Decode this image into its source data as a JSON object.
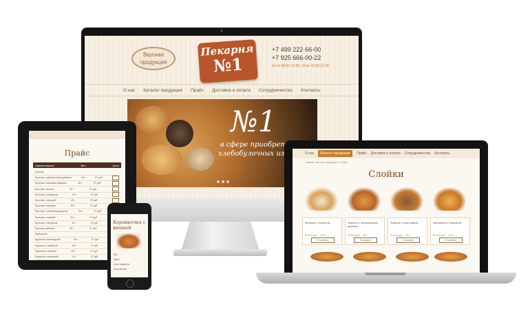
{
  "desktop": {
    "logo_oval": "Вкусная продукция",
    "brand_line1": "Пекарня",
    "brand_line2": "№1",
    "phone1": "+7 499 222-66-00",
    "phone2": "+7 925 666-00-22",
    "phone_note": "пн-пт 08:00-21:00, сб-вс 10:00-21:00",
    "nav": [
      "О нас",
      "Каталог продукции",
      "Прайс",
      "Доставка и оплата",
      "Сотрудничество",
      "Контакты"
    ],
    "hero_number": "№1",
    "hero_text": "в сфере приобретения хлебобулочных изделий"
  },
  "tablet": {
    "title": "Прайс",
    "header": [
      "Наименование",
      "Вес",
      "Цена"
    ],
    "rows": [
      {
        "name": "Булочки",
        "weight": "",
        "price": ""
      },
      {
        "name": "Булочка с абрикосовым джемом",
        "weight": "40 г",
        "price": "27 руб"
      },
      {
        "name": "Булочка с маковым джемом",
        "weight": "40 г",
        "price": "27 руб"
      },
      {
        "name": "Булочка с маком",
        "weight": "40 г",
        "price": "27 руб"
      },
      {
        "name": "Булочка с повидлом",
        "weight": "40 г",
        "price": "27 руб"
      },
      {
        "name": "Булочка с корицей",
        "weight": "40 г",
        "price": "27 руб"
      },
      {
        "name": "Булочка с изюмом",
        "weight": "40 г",
        "price": "27 руб"
      },
      {
        "name": "Булочка с яблочным джемом",
        "weight": "40 г",
        "price": "27 руб"
      },
      {
        "name": "Булочка с вишней",
        "weight": "40 г",
        "price": "27 руб"
      },
      {
        "name": "Булочка с персиком",
        "weight": "40 г",
        "price": "27 руб"
      },
      {
        "name": "Булочка сдобная",
        "weight": "40 г",
        "price": "27 руб"
      },
      {
        "name": "Круассаны",
        "weight": "",
        "price": ""
      },
      {
        "name": "Круассан шоколадный",
        "weight": "40 г",
        "price": "27 руб"
      },
      {
        "name": "Круассан с малиной",
        "weight": "40 г",
        "price": "27 руб"
      },
      {
        "name": "Круассан с вишней",
        "weight": "40 г",
        "price": "27 руб"
      },
      {
        "name": "Круассан сливочный",
        "weight": "40 г",
        "price": "27 руб"
      }
    ]
  },
  "phone": {
    "title": "Корзиночка с вишней",
    "details": [
      "Вес",
      "Цена",
      "Срок годности",
      "Количество"
    ]
  },
  "laptop": {
    "nav": [
      "О нас",
      "Каталог продукции",
      "Прайс",
      "Доставка и оплата",
      "Сотрудничество",
      "Контакты"
    ],
    "active_nav": "Каталог продукции",
    "breadcrumb": "Главная / Каталог продукции / Слойки",
    "title": "Слойки",
    "products": [
      {
        "name": "Вечерка с творогом",
        "weight": "20,00 руб.",
        "price": "100 г",
        "button": "В корзину"
      },
      {
        "name": "Завиток с абрикосовым джемом",
        "weight": "20,00 руб.",
        "price": "95 г",
        "button": "В корзину"
      },
      {
        "name": "Завиток с шоколадом",
        "weight": "20,00 руб.",
        "price": "95 г",
        "button": "В корзину"
      },
      {
        "name": "Звездочка с ананасом",
        "weight": "20,00 руб.",
        "price": "110 г",
        "button": "В корзину"
      }
    ]
  },
  "colors": {
    "accent": "#c87a2a",
    "brand": "#b9552a",
    "text_brown": "#7a4a22"
  }
}
